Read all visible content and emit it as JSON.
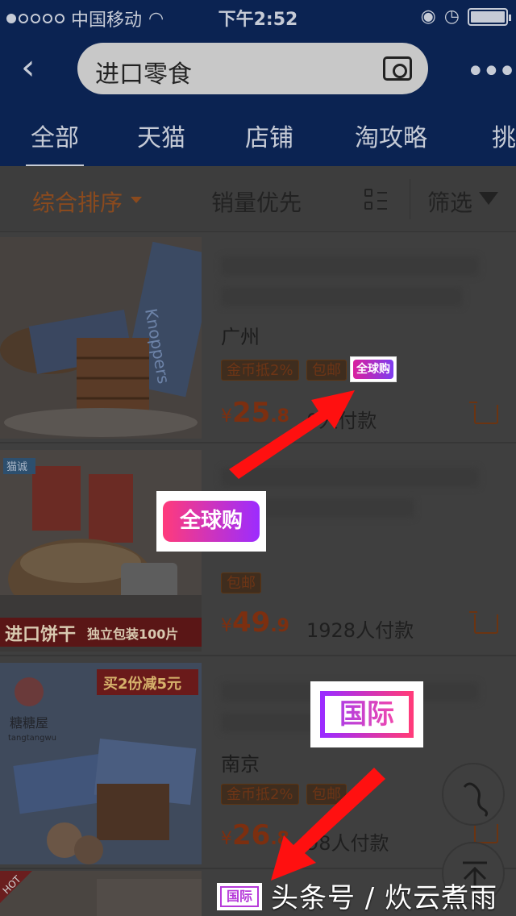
{
  "status_bar": {
    "carrier": "中国移动",
    "time": "下午2:52"
  },
  "search": {
    "query": "进口零食"
  },
  "tabs": [
    {
      "label": "全部",
      "active": true
    },
    {
      "label": "天猫"
    },
    {
      "label": "店铺"
    },
    {
      "label": "淘攻略"
    },
    {
      "label": "挑"
    }
  ],
  "sort": {
    "comprehensive": "综合排序",
    "sales": "销量优先",
    "filter": "筛选"
  },
  "products": [
    {
      "location": "广州",
      "badges": [
        "金币抵2%",
        "包邮"
      ],
      "price_int": "25",
      "price_dec": ".8",
      "paid": "0人付款",
      "thumb_text": "Knoppers"
    },
    {
      "badges": [
        "包邮"
      ],
      "price_int": "49",
      "price_dec": ".9",
      "paid": "1928人付款",
      "banner": "进口饼干",
      "banner_sub": "独立包装100片",
      "corner": "猫诚"
    },
    {
      "location": "南京",
      "badges": [
        "金币抵2%",
        "包邮"
      ],
      "price_int": "26",
      "price_dec": ".8",
      "paid": "98人付款",
      "promo": "买2份减5元",
      "brand": "糖糖屋",
      "brand_sub": "tangtangwu"
    }
  ],
  "partial_item": {
    "tag": "HOT"
  },
  "overlays": {
    "global_buy_small": "全球购",
    "global_buy_large": "全球购",
    "intl_large": "国际",
    "intl_small": "国际"
  },
  "watermark": "头条号 / 炊云煮雨",
  "colors": {
    "header": "#0b2352",
    "price": "#7c2f10",
    "arrow": "#ff1010"
  }
}
